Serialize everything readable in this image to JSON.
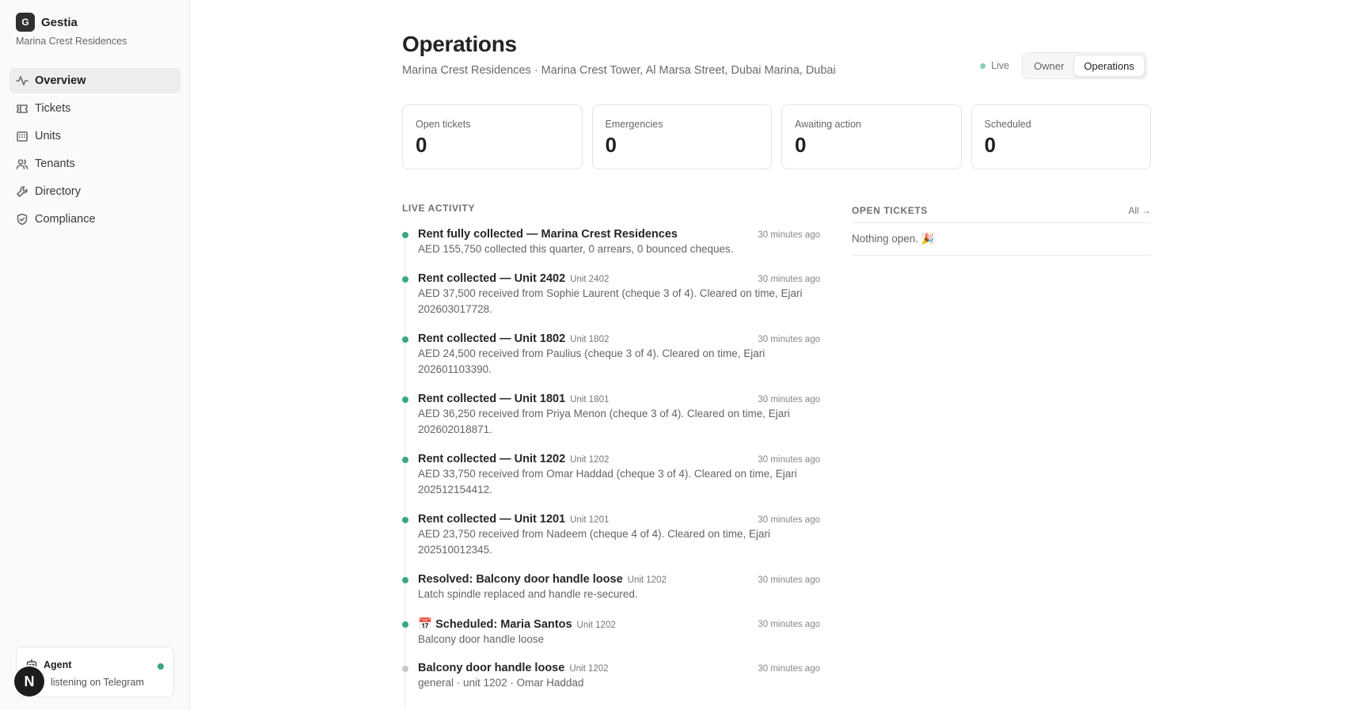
{
  "brand": {
    "logo_letter": "G",
    "name": "Gestia",
    "property": "Marina Crest Residences"
  },
  "nav": [
    {
      "label": "Overview",
      "icon": "activity-icon",
      "active": true
    },
    {
      "label": "Tickets",
      "icon": "ticket-icon",
      "active": false
    },
    {
      "label": "Units",
      "icon": "building-icon",
      "active": false
    },
    {
      "label": "Tenants",
      "icon": "users-icon",
      "active": false
    },
    {
      "label": "Directory",
      "icon": "wrench-icon",
      "active": false
    },
    {
      "label": "Compliance",
      "icon": "shield-icon",
      "active": false
    }
  ],
  "agent": {
    "title": "Agent",
    "status": "listening on Telegram",
    "status_color": "#3aa87a"
  },
  "avatar": {
    "letter": "N"
  },
  "page": {
    "title": "Operations",
    "subtitle": "Marina Crest Residences · Marina Crest Tower, Al Marsa Street, Dubai Marina, Dubai",
    "live_label": "Live",
    "view_toggle": {
      "options": [
        "Owner",
        "Operations"
      ],
      "selected": "Operations"
    }
  },
  "stats": [
    {
      "label": "Open tickets",
      "value": "0"
    },
    {
      "label": "Emergencies",
      "value": "0"
    },
    {
      "label": "Awaiting action",
      "value": "0"
    },
    {
      "label": "Scheduled",
      "value": "0"
    }
  ],
  "activity": {
    "heading": "LIVE ACTIVITY",
    "items": [
      {
        "title": "Rent fully collected — Marina Crest Residences",
        "unit": "",
        "time": "30 minutes ago",
        "desc": "AED 155,750 collected this quarter, 0 arrears, 0 bounced cheques.",
        "status": "green"
      },
      {
        "title": "Rent collected — Unit 2402",
        "unit": "Unit 2402",
        "time": "30 minutes ago",
        "desc": "AED 37,500 received from Sophie Laurent (cheque 3 of 4). Cleared on time, Ejari 202603017728.",
        "status": "green"
      },
      {
        "title": "Rent collected — Unit 1802",
        "unit": "Unit 1802",
        "time": "30 minutes ago",
        "desc": "AED 24,500 received from Paulius (cheque 3 of 4). Cleared on time, Ejari 202601103390.",
        "status": "green"
      },
      {
        "title": "Rent collected — Unit 1801",
        "unit": "Unit 1801",
        "time": "30 minutes ago",
        "desc": "AED 36,250 received from Priya Menon (cheque 3 of 4). Cleared on time, Ejari 202602018871.",
        "status": "green"
      },
      {
        "title": "Rent collected — Unit 1202",
        "unit": "Unit 1202",
        "time": "30 minutes ago",
        "desc": "AED 33,750 received from Omar Haddad (cheque 3 of 4). Cleared on time, Ejari 202512154412.",
        "status": "green"
      },
      {
        "title": "Rent collected — Unit 1201",
        "unit": "Unit 1201",
        "time": "30 minutes ago",
        "desc": "AED 23,750 received from Nadeem (cheque 4 of 4). Cleared on time, Ejari 202510012345.",
        "status": "green"
      },
      {
        "title": "Resolved: Balcony door handle loose",
        "unit": "Unit 1202",
        "time": "30 minutes ago",
        "desc": "Latch spindle replaced and handle re-secured.",
        "status": "green"
      },
      {
        "title": "📅 Scheduled: Maria Santos",
        "unit": "Unit 1202",
        "time": "30 minutes ago",
        "desc": "Balcony door handle loose",
        "status": "green"
      },
      {
        "title": "Balcony door handle loose",
        "unit": "Unit 1202",
        "time": "30 minutes ago",
        "desc": "general · unit 1202 · Omar Haddad",
        "status": "grey"
      }
    ]
  },
  "open_tickets": {
    "heading": "OPEN TICKETS",
    "all_link": "All →",
    "empty": "Nothing open. 🎉"
  },
  "colors": {
    "accent_green": "#3aa87a",
    "live_dot": "#8fcfb1"
  }
}
